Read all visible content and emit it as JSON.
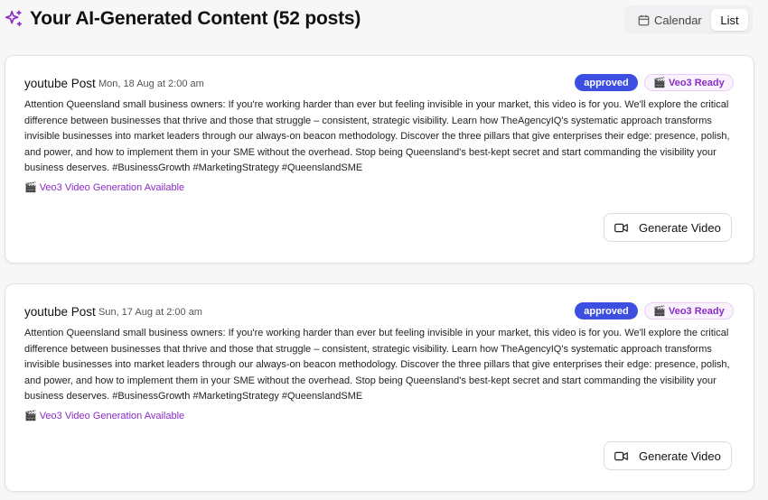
{
  "header": {
    "title": "Your AI-Generated Content (52 posts)",
    "icon": "sparkles-icon",
    "accent_color": "#8a2cc7"
  },
  "view_toggle": {
    "calendar_label": "Calendar",
    "list_label": "List",
    "selected": "List"
  },
  "posts": [
    {
      "type": "youtube Post",
      "date": "Mon, 18 Aug at 2:00 am",
      "status": "approved",
      "veo_badge": "Veo3 Ready",
      "body": "Attention Queensland small business owners: If you're working harder than ever but feeling invisible in your market, this video is for you. We'll explore the critical difference between businesses that thrive and those that struggle – consistent, strategic visibility. Learn how TheAgencyIQ's systematic approach transforms invisible businesses into market leaders through our always-on beacon methodology. Discover the three pillars that give enterprises their edge: presence, polish, and power, and how to implement them in your SME without the overhead. Stop being Queensland's best-kept secret and start commanding the visibility your business deserves. #BusinessGrowth #MarketingStrategy #QueenslandSME",
      "veo_note": "Veo3 Video Generation Available",
      "button_label": "Generate Video"
    },
    {
      "type": "youtube Post",
      "date": "Sun, 17 Aug at 2:00 am",
      "status": "approved",
      "veo_badge": "Veo3 Ready",
      "body": "Attention Queensland small business owners: If you're working harder than ever but feeling invisible in your market, this video is for you. We'll explore the critical difference between businesses that thrive and those that struggle – consistent, strategic visibility. Learn how TheAgencyIQ's systematic approach transforms invisible businesses into market leaders through our always-on beacon methodology. Discover the three pillars that give enterprises their edge: presence, polish, and power, and how to implement them in your SME without the overhead. Stop being Queensland's best-kept secret and start commanding the visibility your business deserves. #BusinessGrowth #MarketingStrategy #QueenslandSME",
      "veo_note": "Veo3 Video Generation Available",
      "button_label": "Generate Video"
    }
  ],
  "colors": {
    "approved_badge": "#3c4fe0",
    "veo_purple": "#8a2cc7"
  }
}
